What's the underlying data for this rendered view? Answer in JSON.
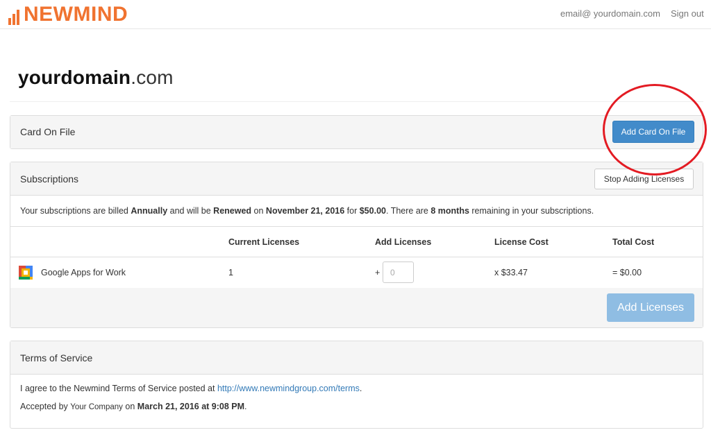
{
  "header": {
    "logo_text": "NEWMIND",
    "email": "email@ yourdomain.com",
    "sign_out": "Sign out"
  },
  "page": {
    "domain_name": "yourdomain",
    "domain_tld": ".com"
  },
  "card_panel": {
    "title": "Card On File",
    "add_button": "Add Card On File"
  },
  "subscriptions": {
    "title": "Subscriptions",
    "stop_button": "Stop Adding Licenses",
    "billing": {
      "prefix": "Your subscriptions are billed ",
      "cycle": "Annually",
      "mid1": " and will be ",
      "status": "Renewed",
      "mid2": " on ",
      "date": "November 21, 2016",
      "mid3": " for ",
      "amount": "$50.00",
      "mid4": ". There are ",
      "remaining": "8 months",
      "suffix": " remaining in your subscriptions."
    },
    "columns": {
      "current": "Current Licenses",
      "add": "Add Licenses",
      "cost": "License Cost",
      "total": "Total Cost"
    },
    "row": {
      "product": "Google Apps for Work",
      "current": "1",
      "plus": "+",
      "add_placeholder": "0",
      "cost": "x $33.47",
      "total": "= $0.00"
    },
    "add_licenses_button": "Add Licenses"
  },
  "terms": {
    "title": "Terms of Service",
    "agree_prefix": "I agree to the Newmind Terms of Service posted at ",
    "terms_link": "http://www.newmindgroup.com/terms",
    "agree_suffix": ".",
    "accepted_prefix": "Accepted by ",
    "company": "Your Company",
    "accepted_mid": " on ",
    "accepted_date": "March 21, 2016 at 9:08 PM",
    "accepted_suffix": "."
  },
  "colors": {
    "brand_orange": "#f07330",
    "primary_blue": "#428bca",
    "disabled_blue": "#8fbde3",
    "annotation_red": "#e31b23",
    "link_blue": "#337ab7"
  },
  "icons": {
    "logo": "bar-chart-logo-icon",
    "product": "google-apps-icon"
  }
}
